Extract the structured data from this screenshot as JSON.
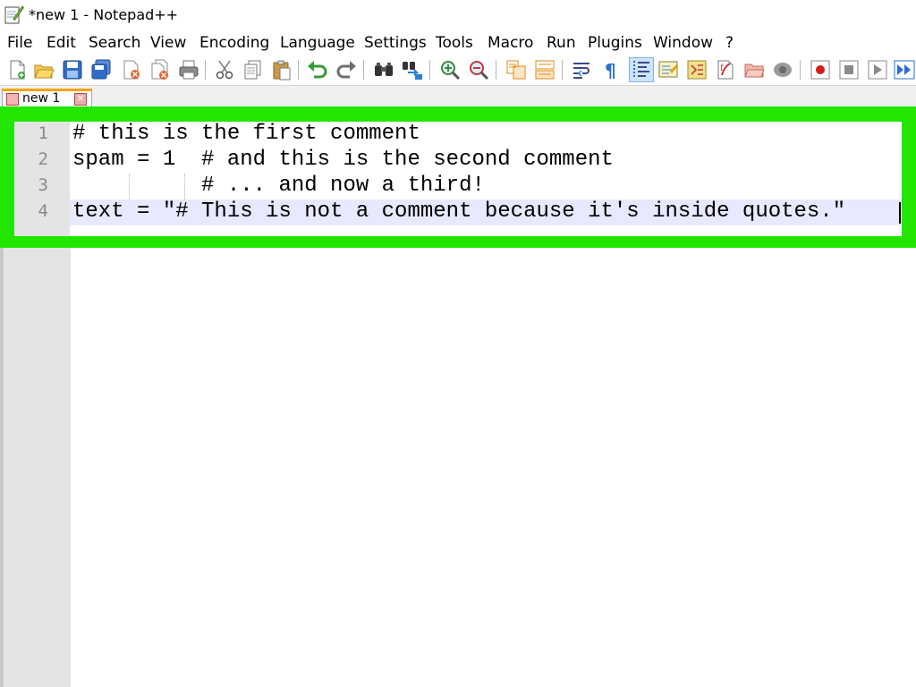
{
  "window": {
    "title": "*new 1 - Notepad++"
  },
  "menu": {
    "items": [
      "File",
      "Edit",
      "Search",
      "View",
      "Encoding",
      "Language",
      "Settings",
      "Tools",
      "Macro",
      "Run",
      "Plugins",
      "Window",
      "?"
    ]
  },
  "toolbar": {
    "icons": [
      "new-file-icon",
      "open-file-icon",
      "save-icon",
      "save-all-icon",
      "close-icon",
      "close-all-icon",
      "print-icon",
      "cut-icon",
      "copy-icon",
      "paste-icon",
      "undo-icon",
      "redo-icon",
      "find-icon",
      "replace-icon",
      "zoom-in-icon",
      "zoom-out-icon",
      "sync-vertical-icon",
      "sync-horizontal-icon",
      "word-wrap-icon",
      "show-all-characters-icon",
      "indent-guide-icon",
      "document-map-icon",
      "function-list-icon",
      "folder-as-workspace-icon",
      "monitoring-icon",
      "record-macro-icon",
      "stop-recording-icon",
      "play-macro-icon",
      "run-macro-multiple-icon"
    ],
    "active_icon": "indent-guide-icon"
  },
  "tabs": [
    {
      "label": "new 1",
      "modified": true
    }
  ],
  "editor": {
    "lines": [
      {
        "number": "1",
        "text": "# this is the first comment"
      },
      {
        "number": "2",
        "text": "spam = 1  # and this is the second comment"
      },
      {
        "number": "3",
        "text": "          # ... and now a third!"
      },
      {
        "number": "4",
        "text": "text = \"# This is not a comment because it's inside quotes.\""
      }
    ],
    "current_line": "4"
  },
  "colors": {
    "highlight_border": "#22e600",
    "current_line_bg": "#e8e8ff",
    "gutter_bg": "#e4e4e4"
  }
}
